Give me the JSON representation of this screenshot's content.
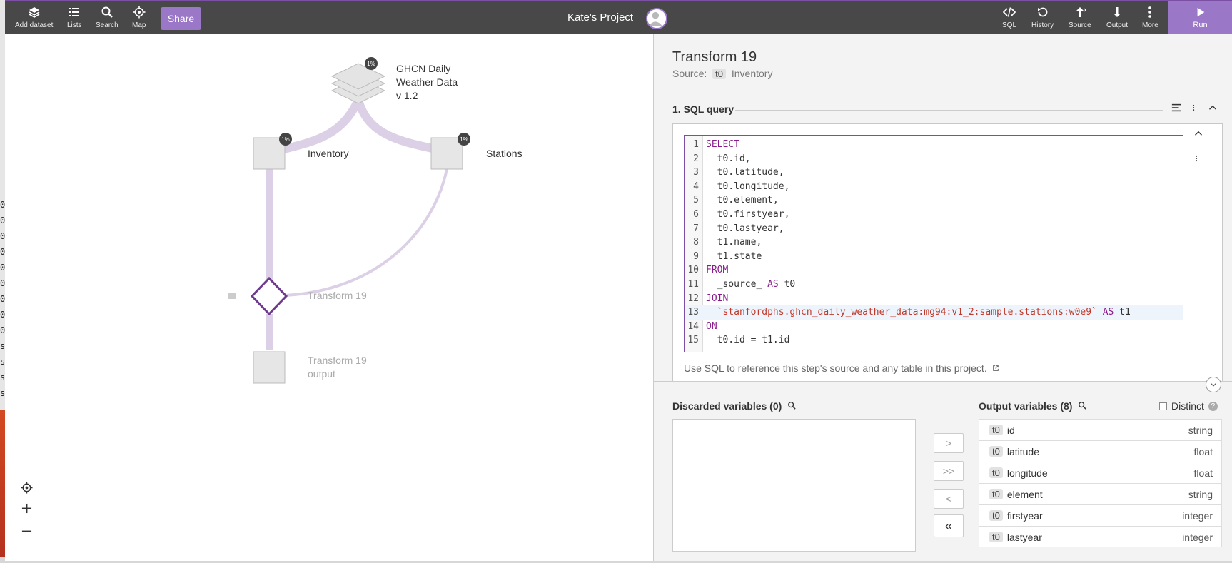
{
  "window": {
    "project_title": "Kate's Project"
  },
  "toolbar_left": [
    {
      "label": "Add dataset",
      "icon": "layers-icon"
    },
    {
      "label": "Lists",
      "icon": "list-icon"
    },
    {
      "label": "Search",
      "icon": "search-icon"
    },
    {
      "label": "Map",
      "icon": "map-target-icon"
    }
  ],
  "share_label": "Share",
  "toolbar_right": [
    {
      "label": "SQL",
      "icon": "code-icon"
    },
    {
      "label": "History",
      "icon": "history-icon"
    },
    {
      "label": "Source",
      "icon": "upload-icon"
    },
    {
      "label": "Output",
      "icon": "download-icon"
    },
    {
      "label": "More",
      "icon": "more-vertical-icon"
    }
  ],
  "run_label": "Run",
  "graph": {
    "dataset": {
      "line1": "GHCN Daily",
      "line2": "Weather Data",
      "line3": "v 1.2",
      "badge": "1%"
    },
    "inventory": {
      "label": "Inventory",
      "badge": "1%"
    },
    "stations": {
      "label": "Stations",
      "badge": "1%"
    },
    "transform": {
      "label": "Transform 19"
    },
    "output": {
      "line1": "Transform 19",
      "line2": "output"
    }
  },
  "panel": {
    "title": "Transform 19",
    "source_label": "Source:",
    "source_tag": "t0",
    "source_name": "Inventory",
    "section_title": "1. SQL query",
    "sql_help": "Use SQL to reference this step's source and any table in this project."
  },
  "sql_lines": [
    {
      "n": "1",
      "kw": "SELECT",
      "text": ""
    },
    {
      "n": "2",
      "kw": "",
      "text": "  t0.id,"
    },
    {
      "n": "3",
      "kw": "",
      "text": "  t0.latitude,"
    },
    {
      "n": "4",
      "kw": "",
      "text": "  t0.longitude,"
    },
    {
      "n": "5",
      "kw": "",
      "text": "  t0.element,"
    },
    {
      "n": "6",
      "kw": "",
      "text": "  t0.firstyear,"
    },
    {
      "n": "7",
      "kw": "",
      "text": "  t0.lastyear,"
    },
    {
      "n": "8",
      "kw": "",
      "text": "  t1.name,"
    },
    {
      "n": "9",
      "kw": "",
      "text": "  t1.state"
    },
    {
      "n": "10",
      "kw": "FROM",
      "text": ""
    },
    {
      "n": "11",
      "kw": "",
      "text": "  _source_ ",
      "kw2": "AS",
      "text2": " t0"
    },
    {
      "n": "12",
      "kw": "JOIN",
      "text": ""
    },
    {
      "n": "13",
      "kw": "",
      "text": "  ",
      "str": "`stanfordphs.ghcn_daily_weather_data:mg94:v1_2:sample.stations:w0e9`",
      "kw2": " AS",
      "text2": " t1"
    },
    {
      "n": "14",
      "kw": "ON",
      "text": ""
    },
    {
      "n": "15",
      "kw": "",
      "text": "  t0.id = t1.id"
    }
  ],
  "variables": {
    "discarded_title": "Discarded variables (0)",
    "output_title": "Output variables (8)",
    "distinct_label": "Distinct",
    "move_buttons": [
      ">",
      ">>",
      "<",
      "«"
    ],
    "outputs": [
      {
        "tag": "t0",
        "name": "id",
        "type": "string"
      },
      {
        "tag": "t0",
        "name": "latitude",
        "type": "float"
      },
      {
        "tag": "t0",
        "name": "longitude",
        "type": "float"
      },
      {
        "tag": "t0",
        "name": "element",
        "type": "string"
      },
      {
        "tag": "t0",
        "name": "firstyear",
        "type": "integer"
      },
      {
        "tag": "t0",
        "name": "lastyear",
        "type": "integer"
      }
    ]
  },
  "background_chars": [
    "0",
    "0",
    "0",
    "0",
    "0",
    "0",
    "0",
    "0",
    "0",
    "s",
    "s",
    "s",
    "s"
  ]
}
